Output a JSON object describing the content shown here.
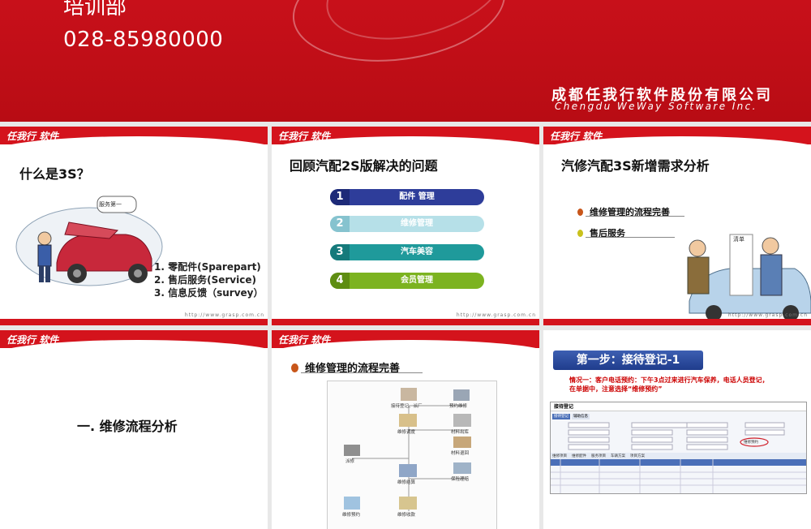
{
  "banner": {
    "dept": "培训部",
    "phone": "028-85980000",
    "company_cn": "成都任我行软件股份有限公司",
    "company_en": "Chengdu WeWay Software Inc."
  },
  "slide_header": {
    "logo": "任我行 软件",
    "url": "http://www.grasp.com.cn"
  },
  "slide1": {
    "title": "什么是3S？",
    "bubble": "服务第一",
    "items": [
      "1. 零配件(Sparepart)",
      "2. 售后服务(Service)",
      "3. 信息反馈（survey）"
    ]
  },
  "slide2": {
    "title": "回顾汽配2S版解决的问题",
    "pills": [
      {
        "num": "1",
        "label": "配件 管理",
        "color": "#2e3d9a"
      },
      {
        "num": "2",
        "label": "维修管理",
        "color": "#9fd3dd"
      },
      {
        "num": "3",
        "label": "汽车美容",
        "color": "#1f9a9b"
      },
      {
        "num": "4",
        "label": "会员管理",
        "color": "#7cb320"
      }
    ]
  },
  "slide3": {
    "title": "汽修汽配3S新增需求分析",
    "bullets": [
      {
        "label": "维修管理的流程完善",
        "color": "#c8561a"
      },
      {
        "label": "售后服务",
        "color": "#c9c11c"
      }
    ],
    "paper": "清单"
  },
  "slide4": {
    "title": "一. 维修流程分析"
  },
  "slide5": {
    "title": "维修管理的流程完善",
    "nodes": [
      "接待登记、派厂",
      "预约维修",
      "维修调度",
      "材料出库",
      "派修",
      "材料退回",
      "维修结算",
      "保险理赔",
      "维修预约",
      "维修收款"
    ]
  },
  "slide6": {
    "step": "第一步：接待登记-1",
    "desc_line1": "情况一：客户电话预约：下午3点过来进行汽车保养，电话人员登记，",
    "desc_line2": "在单据中，注意选择“维修预约”",
    "form_title": "接待登记",
    "form_tabs": [
      "接待登记",
      "辅助信息"
    ],
    "grid_tabs": [
      "维修项目",
      "维修配件",
      "服务项目",
      "车辆方案",
      "项目方案"
    ],
    "highlight": "维修预约"
  }
}
